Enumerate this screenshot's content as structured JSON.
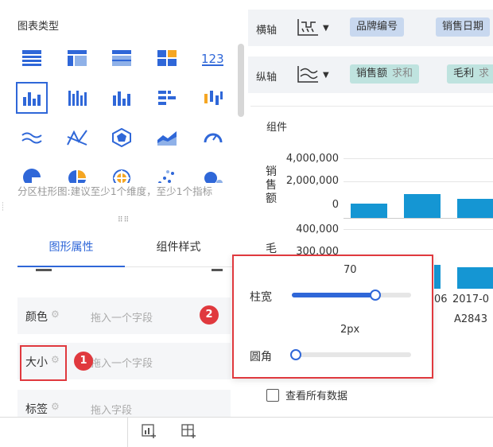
{
  "chart_types": {
    "title": "图表类型",
    "hint": "分区柱形图:建议至少1个维度，至少1个指标",
    "icons": [
      "table-icon",
      "cross-table-icon",
      "detail-table-icon",
      "kpi-card-icon",
      "number-card-icon",
      "grouped-bar-icon",
      "stacked-bar-icon",
      "column-bar-icon",
      "horizontal-bar-icon",
      "waterfall-icon",
      "line-chart-icon",
      "radar-line-icon",
      "radar-chart-icon",
      "area-chart-icon",
      "gauge-icon",
      "pie-chart-icon",
      "sector-pie-icon",
      "rose-chart-icon",
      "scatter-icon",
      "bubble-icon"
    ]
  },
  "tabs": {
    "active": "图形属性",
    "inactive": "组件样式"
  },
  "properties": [
    {
      "label": "颜色",
      "placeholder": "拖入一个字段"
    },
    {
      "label": "大小",
      "placeholder": "拖入一个字段"
    },
    {
      "label": "标签",
      "placeholder": "拖入字段"
    }
  ],
  "badges": {
    "one": "1",
    "two": "2"
  },
  "axes": {
    "x_label": "横轴",
    "y_label": "纵轴",
    "x_fields": [
      "品牌编号",
      "销售日期"
    ],
    "y_fields": [
      {
        "name": "销售额",
        "agg": "求和"
      },
      {
        "name": "毛利",
        "agg": "求"
      }
    ]
  },
  "chart": {
    "title": "组件",
    "ylabel_top": "销售额",
    "ylabel_bottom": "毛",
    "ticks_top": [
      "4,000,000",
      "2,000,000",
      "0"
    ],
    "ticks_bottom": [
      "400,000",
      "300,000"
    ],
    "xticks": [
      "06",
      "2017-0",
      "A2843"
    ]
  },
  "chart_data": {
    "type": "bar",
    "title": "组件",
    "ylabel": "销售额",
    "ylim": [
      0,
      4000000
    ],
    "values": [
      700000,
      1150000,
      900000
    ],
    "lower_panel": {
      "ylabel": "毛",
      "ylim": [
        0,
        400000
      ]
    }
  },
  "popup": {
    "width_value": "70",
    "width_label": "柱宽",
    "width_fraction": 0.7,
    "radius_value": "2px",
    "radius_label": "圆角",
    "radius_fraction": 0.0
  },
  "footer": {
    "show_all_data": "查看所有数据"
  },
  "colors": {
    "accent": "#2f67d8",
    "bar": "#1596d3",
    "highlight": "#e0393e"
  }
}
